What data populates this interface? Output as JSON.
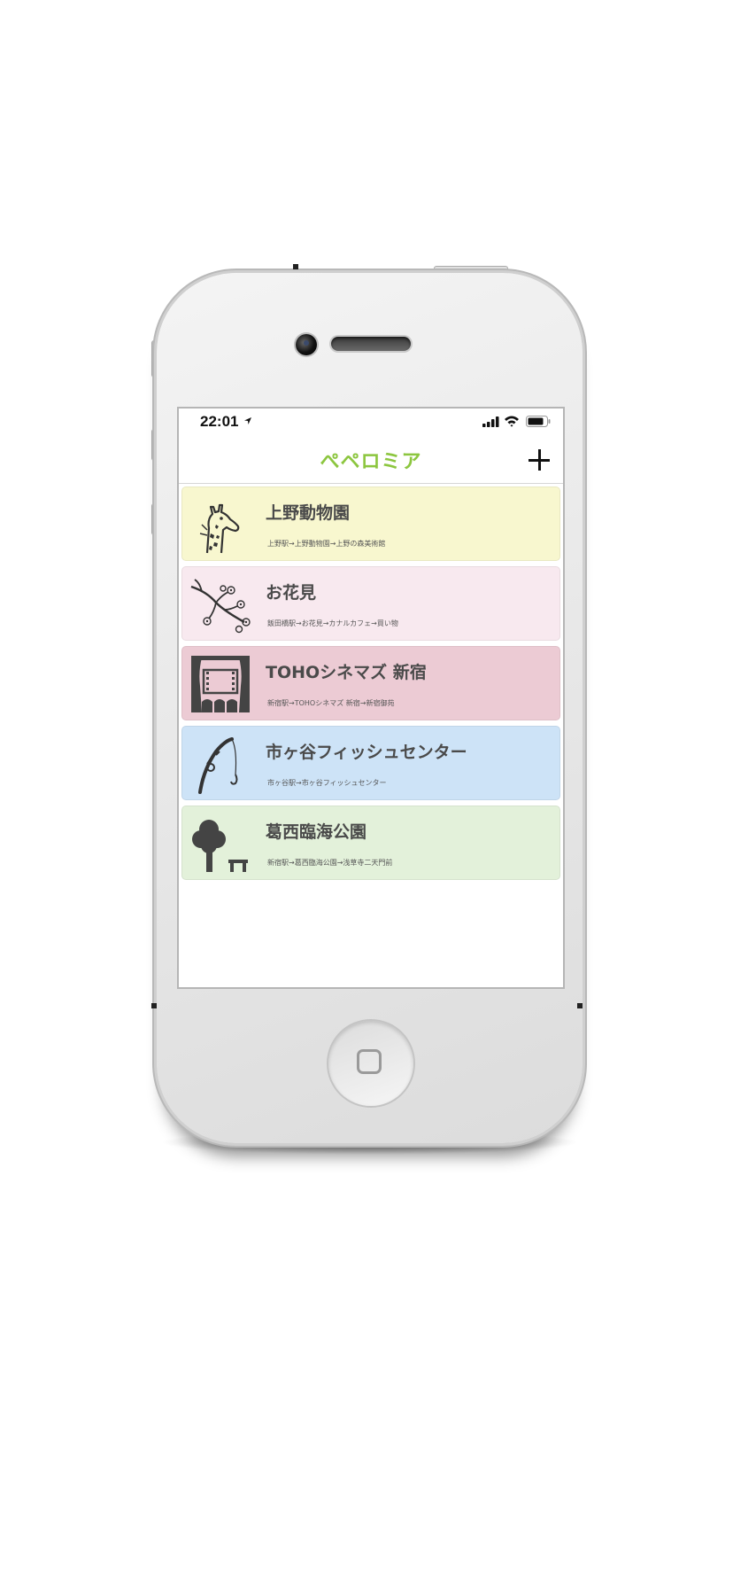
{
  "status_bar": {
    "time": "22:01",
    "location_icon": "location-arrow-icon",
    "signal_icon": "cellular-signal-icon",
    "wifi_icon": "wifi-icon",
    "battery_icon": "battery-icon"
  },
  "nav": {
    "title": "ぺペロミア",
    "add_icon": "plus-icon",
    "title_color": "#8cc63f"
  },
  "plans": [
    {
      "title": "上野動物園",
      "route": "上野駅→上野動物園→上野の森美術館",
      "icon": "giraffe-icon",
      "color": "#f8f7cf"
    },
    {
      "title": "お花見",
      "route": "飯田橋駅→お花見→カナルカフェ→買い物",
      "icon": "cherry-blossom-branch-icon",
      "color": "#f8e9ef"
    },
    {
      "title": "TOHOシネマズ 新宿",
      "route": "新宿駅→TOHOシネマズ 新宿→新宿御苑",
      "icon": "movie-theater-icon",
      "color": "#eccbd4"
    },
    {
      "title": "市ヶ谷フィッシュセンター",
      "route": "市ヶ谷駅→市ヶ谷フィッシュセンター",
      "icon": "fishing-rod-icon",
      "color": "#cde3f7"
    },
    {
      "title": "葛西臨海公園",
      "route": "新宿駅→葛西臨海公園→浅草寺二天門前",
      "icon": "tree-bench-icon",
      "color": "#e3f1da"
    }
  ]
}
